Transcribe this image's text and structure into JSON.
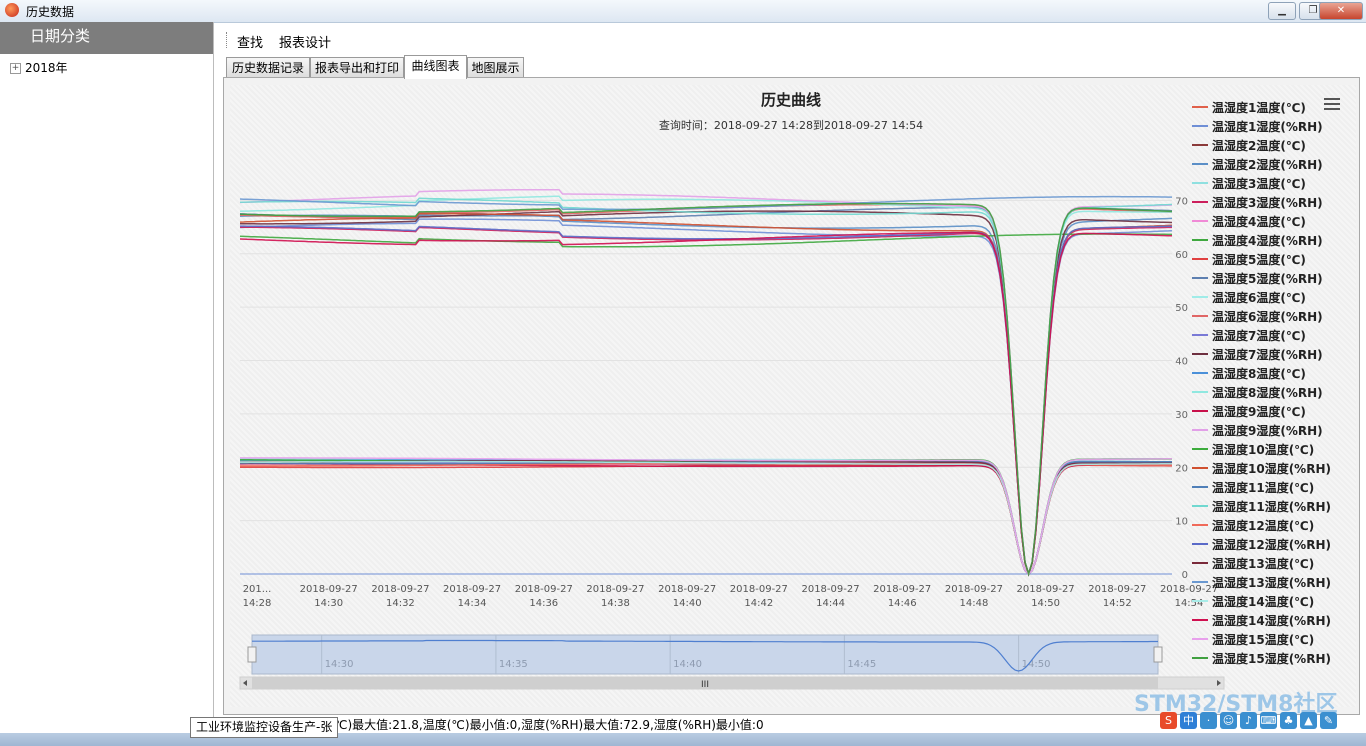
{
  "window": {
    "title": "历史数据",
    "btn_min": "▁",
    "btn_max": "❐",
    "btn_close": "✕"
  },
  "sidebar": {
    "header": "日期分类",
    "tree": [
      {
        "label": "2018年",
        "expander": "+"
      }
    ]
  },
  "toolbar": {
    "items": [
      "查找",
      "报表设计"
    ]
  },
  "tabs": [
    "历史数据记录",
    "报表导出和打印",
    "曲线图表",
    "地图展示"
  ],
  "active_tab": 2,
  "chart_data": {
    "type": "line",
    "title": "历史曲线",
    "subtitle": "查询时间：2018-09-27 14:28到2018-09-27 14:54",
    "ylim": [
      0,
      80
    ],
    "y_ticks": [
      "0",
      "10",
      "20",
      "30",
      "40",
      "50",
      "60",
      "70"
    ],
    "y_tick_values": [
      0,
      10,
      20,
      30,
      40,
      50,
      60,
      70
    ],
    "x_ticks": [
      {
        "date": "201...",
        "time": "14:28"
      },
      {
        "date": "2018-09-27",
        "time": "14:30"
      },
      {
        "date": "2018-09-27",
        "time": "14:32"
      },
      {
        "date": "2018-09-27",
        "time": "14:34"
      },
      {
        "date": "2018-09-27",
        "time": "14:36"
      },
      {
        "date": "2018-09-27",
        "time": "14:38"
      },
      {
        "date": "2018-09-27",
        "time": "14:40"
      },
      {
        "date": "2018-09-27",
        "time": "14:42"
      },
      {
        "date": "2018-09-27",
        "time": "14:44"
      },
      {
        "date": "2018-09-27",
        "time": "14:46"
      },
      {
        "date": "2018-09-27",
        "time": "14:48"
      },
      {
        "date": "2018-09-27",
        "time": "14:50"
      },
      {
        "date": "2018-09-27",
        "time": "14:52"
      },
      {
        "date": "2018-09-27",
        "time": "14:54"
      }
    ],
    "x_minutes": [
      28,
      30,
      32,
      34,
      36,
      38,
      40,
      42,
      44,
      46,
      48,
      50,
      52,
      54
    ],
    "grid": true,
    "legend_position": "right",
    "series": [
      {
        "name": "温湿度1温度(℃)",
        "color": "#e0604a",
        "base": 21.0,
        "dip": true
      },
      {
        "name": "温湿度1湿度(%RH)",
        "color": "#6f8fd6",
        "base": 64.5,
        "dip": true
      },
      {
        "name": "温湿度2温度(℃)",
        "color": "#8b3a3a",
        "base": 20.6,
        "dip": true
      },
      {
        "name": "温湿度2湿度(%RH)",
        "color": "#5b8fc7",
        "base": 66.0,
        "dip": true
      },
      {
        "name": "温湿度3温度(℃)",
        "color": "#8fe0e0",
        "base": 21.4,
        "dip": true
      },
      {
        "name": "温湿度3湿度(%RH)",
        "color": "#cc1f5c",
        "base": 63.8,
        "dip": true
      },
      {
        "name": "温湿度4温度(℃)",
        "color": "#f08ad6",
        "base": 20.8,
        "dip": true
      },
      {
        "name": "温湿度4湿度(%RH)",
        "color": "#3fa83f",
        "base": 62.5,
        "dip": false
      },
      {
        "name": "温湿度5温度(℃)",
        "color": "#e04040",
        "base": 20.2,
        "dip": true
      },
      {
        "name": "温湿度5湿度(%RH)",
        "color": "#5d7fb0",
        "base": 67.5,
        "dip": true
      },
      {
        "name": "温湿度6温度(℃)",
        "color": "#a0ece8",
        "base": 21.2,
        "dip": true
      },
      {
        "name": "温湿度6湿度(%RH)",
        "color": "#e06666",
        "base": 68.0,
        "dip": true
      },
      {
        "name": "温湿度7温度(℃)",
        "color": "#7a7ad6",
        "base": 20.7,
        "dip": true
      },
      {
        "name": "温湿度7湿度(%RH)",
        "color": "#6e3040",
        "base": 66.8,
        "dip": true
      },
      {
        "name": "温湿度8温度(℃)",
        "color": "#4a90d9",
        "base": 21.1,
        "dip": true
      },
      {
        "name": "温湿度8湿度(%RH)",
        "color": "#90e8e0",
        "base": 69.0,
        "dip": true
      },
      {
        "name": "温湿度9温度(℃)",
        "color": "#c8104a",
        "base": 20.4,
        "dip": true
      },
      {
        "name": "温湿度9湿度(%RH)",
        "color": "#e2a0e8",
        "base": 70.0,
        "dip": true
      },
      {
        "name": "温湿度10温度(℃)",
        "color": "#3cac3c",
        "base": 21.3,
        "dip": true
      },
      {
        "name": "温湿度10湿度(%RH)",
        "color": "#d05030",
        "base": 65.5,
        "dip": true
      },
      {
        "name": "温湿度11温度(℃)",
        "color": "#4f7fb8",
        "base": 20.9,
        "dip": true
      },
      {
        "name": "温湿度11湿度(%RH)",
        "color": "#70d8d0",
        "base": 68.6,
        "dip": true
      },
      {
        "name": "温湿度12温度(℃)",
        "color": "#f06a5a",
        "base": 20.5,
        "dip": true
      },
      {
        "name": "温湿度12湿度(%RH)",
        "color": "#5a6ac8",
        "base": 64.0,
        "dip": true
      },
      {
        "name": "温湿度13温度(℃)",
        "color": "#7a2a3a",
        "base": 21.0,
        "dip": true
      },
      {
        "name": "温湿度13湿度(%RH)",
        "color": "#6a98d0",
        "base": 69.5,
        "dip": false
      },
      {
        "name": "温湿度14温度(℃)",
        "color": "#a8ece8",
        "base": 20.8,
        "dip": true
      },
      {
        "name": "温湿度14湿度(%RH)",
        "color": "#d01050",
        "base": 62.8,
        "dip": true
      },
      {
        "name": "温湿度15温度(℃)",
        "color": "#e8a0ec",
        "base": 21.5,
        "dip": true
      },
      {
        "name": "温湿度15湿度(%RH)",
        "color": "#40a040",
        "base": 68.2,
        "dip": true
      }
    ],
    "navigator_ticks": [
      "14:30",
      "14:35",
      "14:40",
      "14:45",
      "14:50"
    ],
    "navigator_minutes": [
      30,
      35,
      40,
      45,
      50
    ],
    "scroll_grip": "III"
  },
  "statusbar": {
    "text": "℃)最大值:21.8,温度(℃)最小值:0,湿度(%RH)最大值:72.9,湿度(%RH)最小值:0",
    "tooltip": "工业环境监控设备生产-张"
  },
  "watermark": "STM32/STM8社区",
  "tray": {
    "ime": "中"
  }
}
